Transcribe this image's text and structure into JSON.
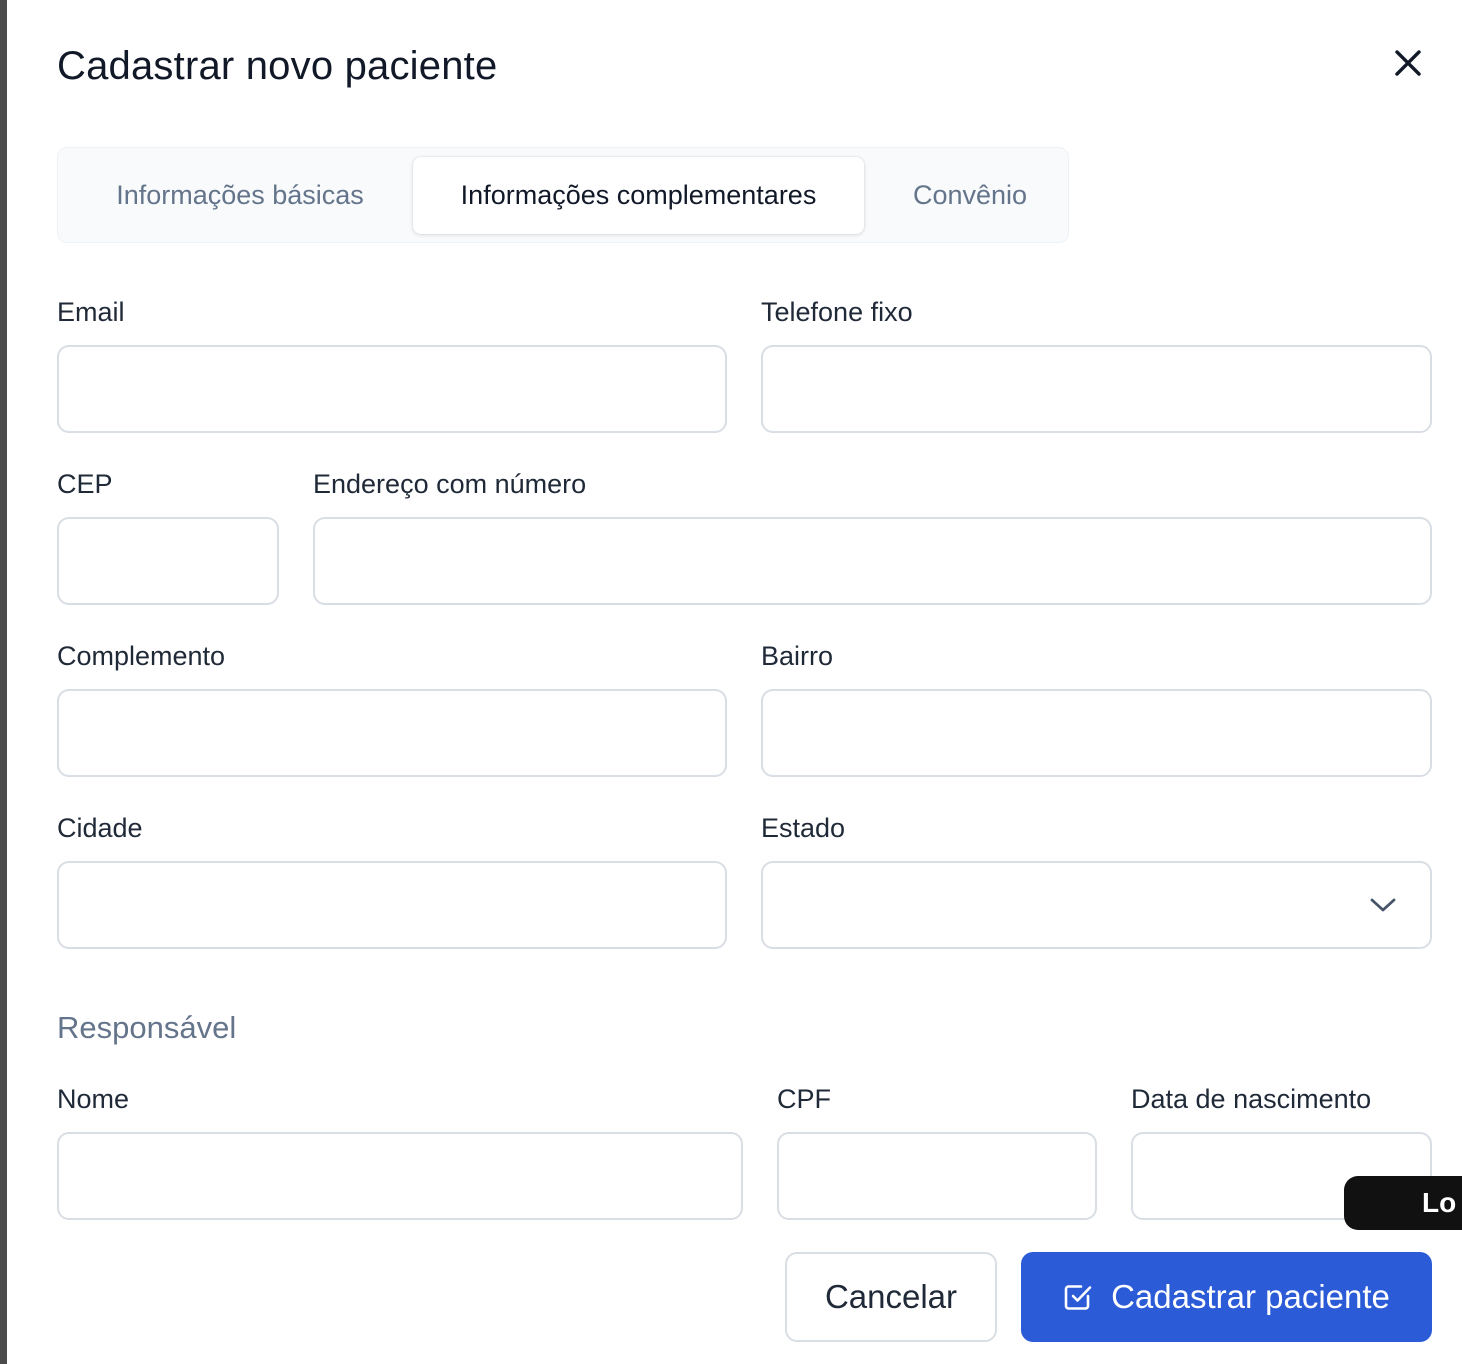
{
  "modal": {
    "title": "Cadastrar novo paciente"
  },
  "tabs": [
    {
      "label": "Informações básicas",
      "active": false
    },
    {
      "label": "Informações complementares",
      "active": true
    },
    {
      "label": "Convênio",
      "active": false
    }
  ],
  "fields": {
    "email": {
      "label": "Email",
      "value": ""
    },
    "telefone_fixo": {
      "label": "Telefone fixo",
      "value": ""
    },
    "cep": {
      "label": "CEP",
      "value": ""
    },
    "endereco": {
      "label": "Endereço com número",
      "value": ""
    },
    "complemento": {
      "label": "Complemento",
      "value": ""
    },
    "bairro": {
      "label": "Bairro",
      "value": ""
    },
    "cidade": {
      "label": "Cidade",
      "value": ""
    },
    "estado": {
      "label": "Estado",
      "value": ""
    }
  },
  "responsavel": {
    "section_title": "Responsável",
    "nome": {
      "label": "Nome",
      "value": ""
    },
    "cpf": {
      "label": "CPF",
      "value": ""
    },
    "data_nascimento": {
      "label": "Data de nascimento",
      "value": ""
    }
  },
  "footer": {
    "cancel_label": "Cancelar",
    "submit_label": "Cadastrar paciente"
  },
  "overlay_pill": {
    "label": "Lo"
  },
  "colors": {
    "primary": "#2b5bd7",
    "border": "#d9dee5",
    "muted_text": "#64748b"
  }
}
